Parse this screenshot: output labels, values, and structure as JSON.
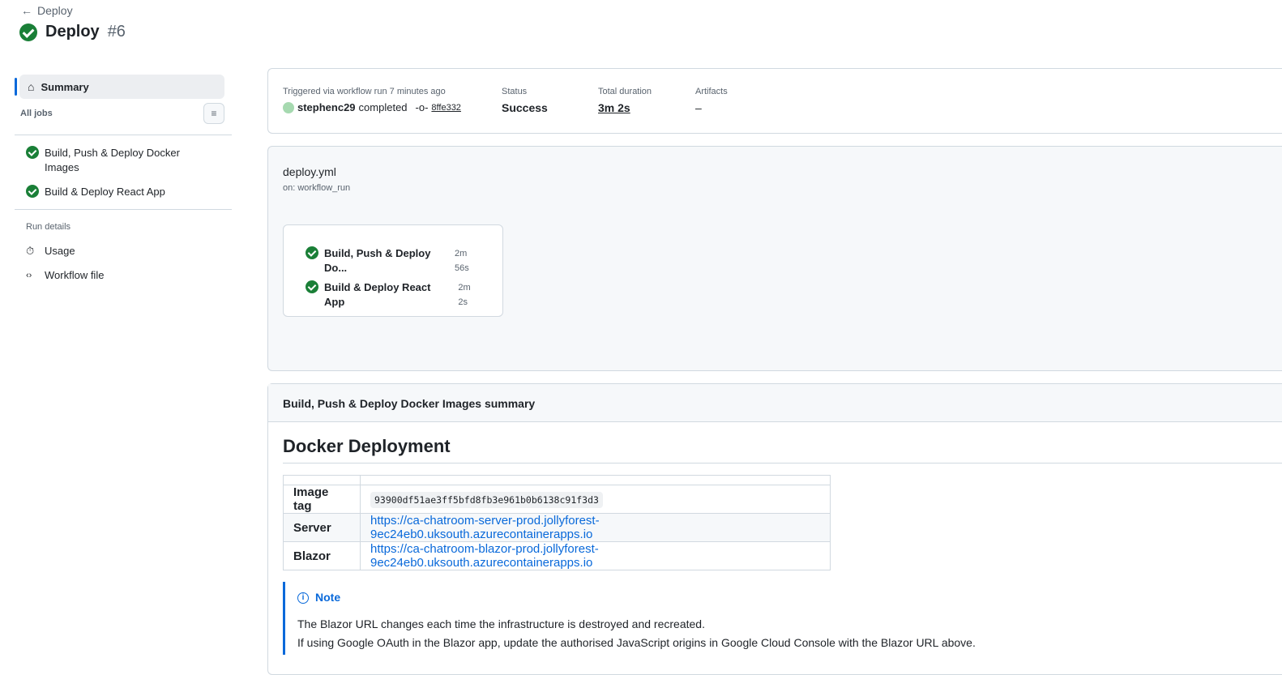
{
  "header": {
    "back_label": "Deploy",
    "title": "Deploy",
    "run_number": "#6"
  },
  "sidebar": {
    "summary": "Summary",
    "all_jobs": "All jobs",
    "jobs": [
      "Build, Push & Deploy Docker Images",
      "Build & Deploy React App"
    ],
    "run_details": "Run details",
    "usage": "Usage",
    "workflow_file": "Workflow file"
  },
  "run_info": {
    "trigger_label": "Triggered via workflow run 7 minutes ago",
    "user": "stephenc29",
    "completed": "completed",
    "commit": "8ffe332",
    "status_label": "Status",
    "status": "Success",
    "duration_label": "Total duration",
    "duration": "3m 2s",
    "artifacts_label": "Artifacts",
    "artifacts": "–"
  },
  "workflow": {
    "file": "deploy.yml",
    "trigger": "on: workflow_run",
    "jobs": [
      {
        "name": "Build, Push & Deploy Do...",
        "time": "2m 56s"
      },
      {
        "name": "Build & Deploy React App",
        "time": "2m 2s"
      }
    ]
  },
  "summary": {
    "header": "Build, Push & Deploy Docker Images summary",
    "heading": "Docker Deployment",
    "rows": [
      {
        "key": "Image tag",
        "value": "93900df51ae3ff5bfd8fb3e961b0b6138c91f3d3"
      },
      {
        "key": "Server",
        "value": "https://ca-chatroom-server-prod.jollyforest-9ec24eb0.uksouth.azurecontainerapps.io"
      },
      {
        "key": "Blazor",
        "value": "https://ca-chatroom-blazor-prod.jollyforest-9ec24eb0.uksouth.azurecontainerapps.io"
      }
    ],
    "note_title": "Note",
    "note_lines": [
      "The Blazor URL changes each time the infrastructure is destroyed and recreated.",
      "If using Google OAuth in the Blazor app, update the authorised JavaScript origins in Google Cloud Console with the Blazor URL above."
    ]
  },
  "colors": {
    "success": "#1a7f37",
    "accent": "#0969da"
  }
}
